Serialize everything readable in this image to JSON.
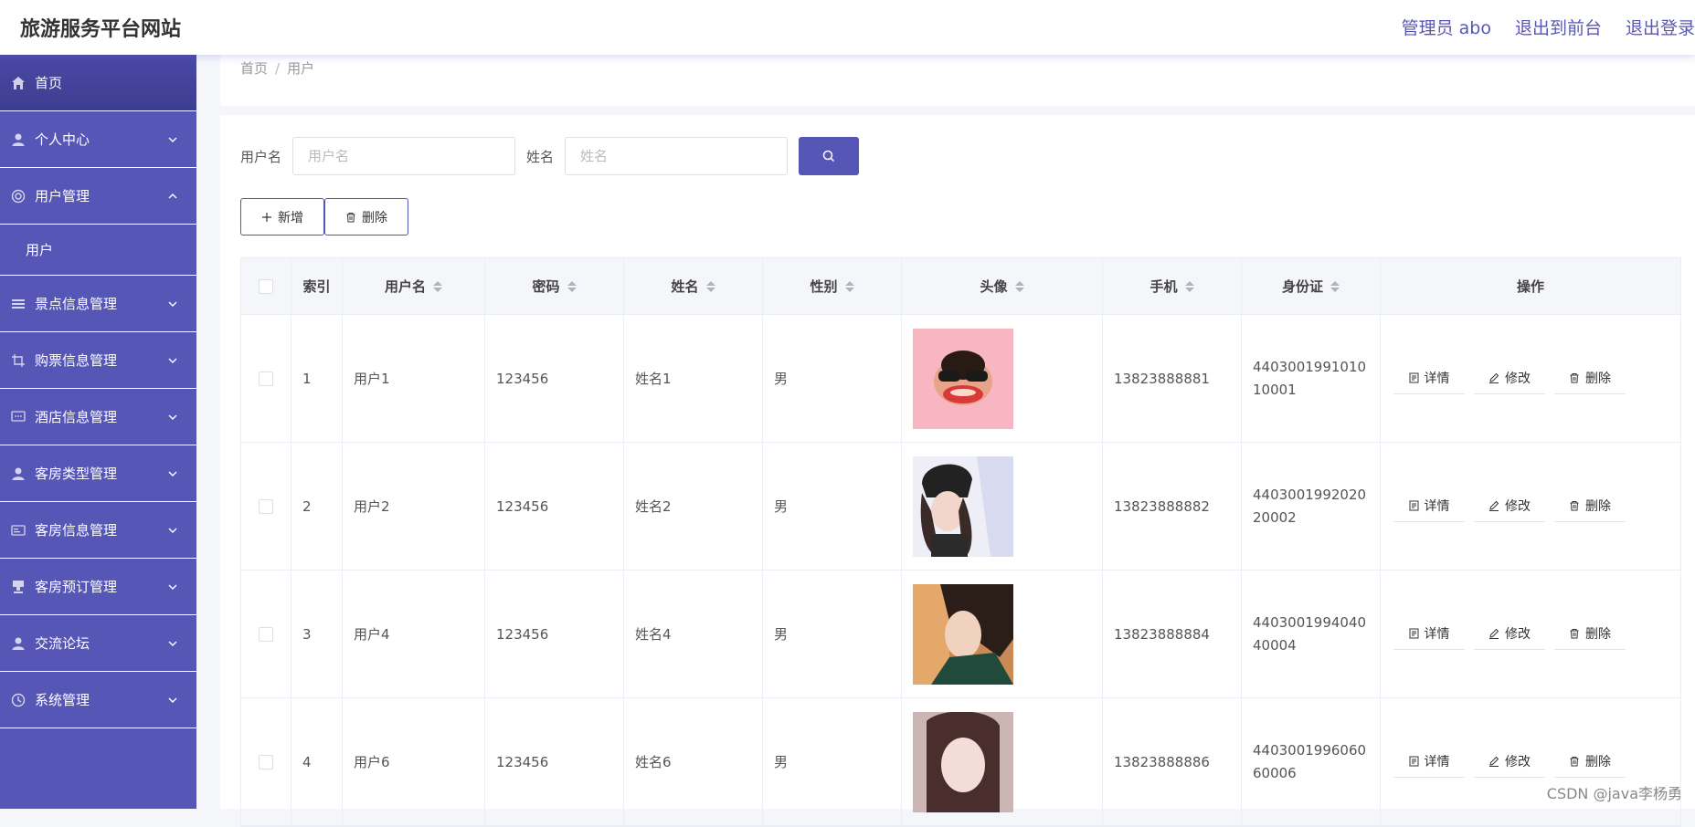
{
  "header": {
    "title": "旅游服务平台网站",
    "admin": "管理员 abo",
    "to_front": "退出到前台",
    "logout": "退出登录"
  },
  "sidebar": {
    "items": [
      {
        "label": "首页",
        "icon": "home-icon"
      },
      {
        "label": "个人中心",
        "icon": "user-icon"
      },
      {
        "label": "用户管理",
        "icon": "life-ring-icon",
        "expanded": true,
        "sub": "用户"
      },
      {
        "label": "景点信息管理",
        "icon": "list-icon"
      },
      {
        "label": "购票信息管理",
        "icon": "crop-icon"
      },
      {
        "label": "酒店信息管理",
        "icon": "chat-icon"
      },
      {
        "label": "客房类型管理",
        "icon": "user-icon"
      },
      {
        "label": "客房信息管理",
        "icon": "card-icon"
      },
      {
        "label": "客房预订管理",
        "icon": "stamp-icon"
      },
      {
        "label": "交流论坛",
        "icon": "user-icon"
      },
      {
        "label": "系统管理",
        "icon": "clock-icon"
      }
    ]
  },
  "breadcrumb": {
    "home": "首页",
    "sep": "/",
    "current": "用户"
  },
  "search": {
    "username_label": "用户名",
    "username_placeholder": "用户名",
    "name_label": "姓名",
    "name_placeholder": "姓名"
  },
  "actions": {
    "add": "新增",
    "delete": "删除"
  },
  "table": {
    "headers": [
      "索引",
      "用户名",
      "密码",
      "姓名",
      "性别",
      "头像",
      "手机",
      "身份证",
      "操作"
    ],
    "rows": [
      {
        "idx": "1",
        "username": "用户1",
        "password": "123456",
        "name": "姓名1",
        "sex": "男",
        "phone": "13823888881",
        "idcard": "440300199101010001"
      },
      {
        "idx": "2",
        "username": "用户2",
        "password": "123456",
        "name": "姓名2",
        "sex": "男",
        "phone": "13823888882",
        "idcard": "440300199202020002"
      },
      {
        "idx": "3",
        "username": "用户4",
        "password": "123456",
        "name": "姓名4",
        "sex": "男",
        "phone": "13823888884",
        "idcard": "440300199404040004"
      },
      {
        "idx": "4",
        "username": "用户6",
        "password": "123456",
        "name": "姓名6",
        "sex": "男",
        "phone": "13823888886",
        "idcard": "440300199606060006"
      }
    ],
    "op_labels": {
      "detail": "详情",
      "edit": "修改",
      "delete": "删除"
    }
  },
  "watermark": "CSDN @java李杨勇",
  "colors": {
    "accent": "#5556b6",
    "header_text": "#5a56b8"
  }
}
